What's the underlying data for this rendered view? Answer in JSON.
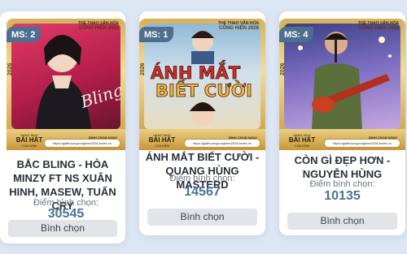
{
  "cards": [
    {
      "ms": "MS: 2",
      "title": "BẮC BLING - HÒA MINZY FT NS XUÂN HINH, MASEW, TUẤN CRY",
      "score_label": "Điểm bình chọn:",
      "score": "30545",
      "button": "Bình chọn",
      "year": "2026",
      "brand_top": "THỂ THAO VĂN HÓA",
      "brand_sub": "CỐNG HIẾN 2026",
      "award_small": "HẠNG MỤC",
      "award_big": "BÀI HÁT",
      "award_tail": "CỦA NĂM",
      "vote_now": "BÌNH CHỌN NGAY",
      "url": "https://giaithuongconghien2026.bvote.vn"
    },
    {
      "ms": "MS: 1",
      "title": "ÁNH MẮT BIẾT CƯỜI - QUANG HÙNG MASTERD",
      "score_label": "Điểm bình chọn:",
      "score": "14567",
      "button": "Bình chọn",
      "year": "2026",
      "brand_top": "THỂ THAO VĂN HÓA",
      "brand_sub": "CỐNG HIẾN 2026",
      "award_small": "HẠNG MỤC",
      "award_big": "BÀI HÁT",
      "award_tail": "CỦA NĂM",
      "vote_now": "BÌNH CHỌN NGAY",
      "url": "https://giaithuongconghien2026.bvote.vn",
      "poster_text": "ÁNH MẮT BIẾT CƯỜI"
    },
    {
      "ms": "MS: 4",
      "title": "CÒN GÌ ĐẸP HƠN - NGUYỄN HÙNG",
      "score_label": "Điểm bình chọn:",
      "score": "10135",
      "button": "Bình chọn",
      "year": "2026",
      "brand_top": "THỂ THAO VĂN HÓA",
      "brand_sub": "CỐNG HIẾN 2026",
      "award_small": "HẠNG MỤC",
      "award_big": "BÀI HÁT",
      "award_tail": "CỦA NĂM",
      "vote_now": "BÌNH CHỌN NGAY",
      "url": "https://giaithuongconghien2026.bvote.vn"
    }
  ],
  "colors": {
    "accent": "#4d7394",
    "badge": "#4d6e8d",
    "gold": "#d6b15b",
    "background": "#dde6f3"
  }
}
